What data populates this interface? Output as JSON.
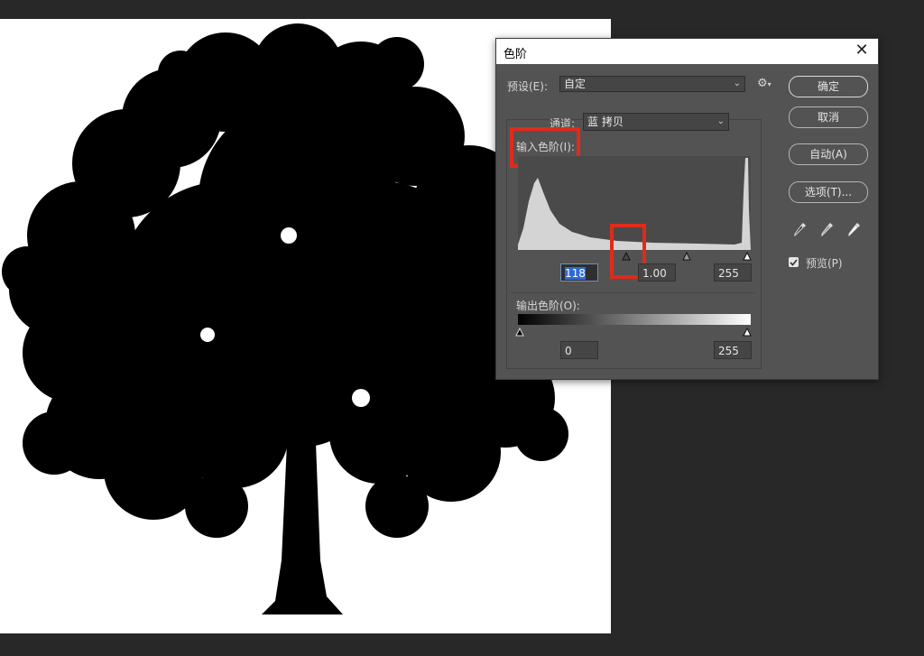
{
  "dialog": {
    "title": "色阶",
    "preset_label": "预设(E):",
    "preset_value": "自定",
    "channel_label": "通道:",
    "channel_value": "蓝 拷贝",
    "input_levels_label": "输入色阶(I):",
    "output_levels_label": "输出色阶(O):",
    "input_black": "118",
    "input_gamma": "1.00",
    "input_white": "255",
    "output_black": "0",
    "output_white": "255",
    "buttons": {
      "ok": "确定",
      "cancel": "取消",
      "auto": "自动(A)",
      "options": "选项(T)..."
    },
    "preview_label": "预览(P)",
    "preview_checked": true
  },
  "icons": {
    "close": "close-icon",
    "gear": "gear-icon",
    "eyedroppers": [
      "black-eyedropper-icon",
      "gray-eyedropper-icon",
      "white-eyedropper-icon"
    ]
  },
  "colors": {
    "highlight": "#e02b1a",
    "dialog_bg": "#535353",
    "workspace_bg": "#282828"
  }
}
